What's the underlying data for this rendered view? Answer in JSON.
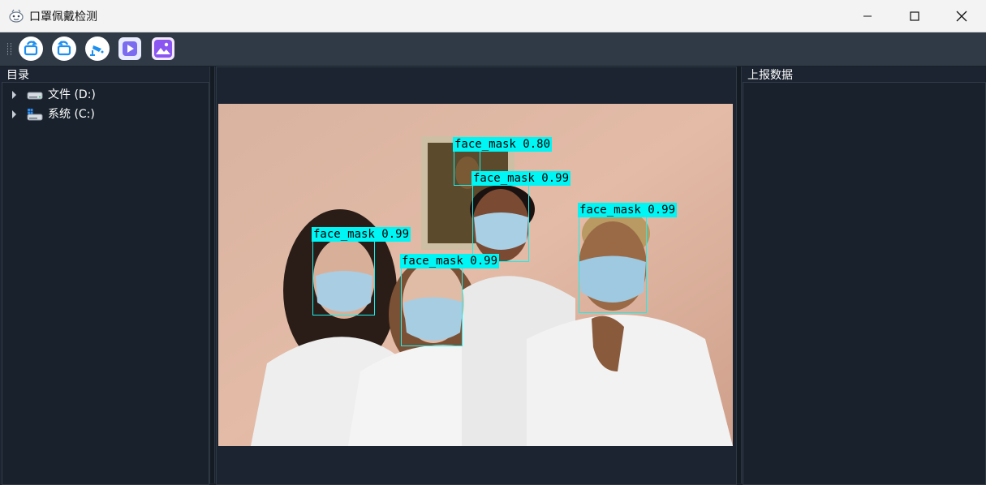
{
  "window": {
    "title": "口罩佩戴检测"
  },
  "toolbar": {
    "buttons": [
      {
        "name": "open-folder",
        "color": "#1d8ff0"
      },
      {
        "name": "refresh",
        "color": "#1d8ff0"
      },
      {
        "name": "camera",
        "color": "#1d8ff0"
      },
      {
        "name": "video-play",
        "color": "#7c6cf0"
      },
      {
        "name": "image",
        "color": "#7c4ff0"
      }
    ]
  },
  "left_panel": {
    "title": "目录",
    "tree": [
      {
        "label": "文件 (D:)",
        "icon": "drive-icon"
      },
      {
        "label": "系统 (C:)",
        "icon": "system-drive-icon"
      }
    ]
  },
  "right_panel": {
    "title": "上报数据"
  },
  "detections": [
    {
      "label": "face_mask 0.80"
    },
    {
      "label": "face_mask 0.99"
    },
    {
      "label": "face_mask 0.99"
    },
    {
      "label": "face_mask 0.99"
    },
    {
      "label": "face_mask 0.99"
    }
  ],
  "colors": {
    "accent": "#00f5f5",
    "background": "#1b2430",
    "toolbar": "#2f3a46"
  }
}
